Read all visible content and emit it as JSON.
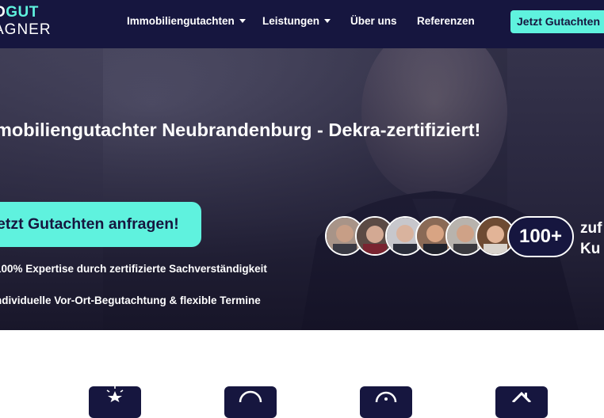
{
  "logo": {
    "line1_prefix": "O",
    "line1_highlight": "GUT",
    "line2": "AGNER"
  },
  "nav": {
    "items": [
      {
        "label": "Immobiliengutachten",
        "has_dropdown": true
      },
      {
        "label": "Leistungen",
        "has_dropdown": true
      },
      {
        "label": "Über uns",
        "has_dropdown": false
      },
      {
        "label": "Referenzen",
        "has_dropdown": false
      }
    ],
    "cta_label": "Jetzt Gutachten"
  },
  "hero": {
    "title": "mobiliengutachter Neubrandenburg - Dekra-zertifiziert!",
    "cta_label": "etzt Gutachten anfragen!",
    "features": [
      "100% Expertise durch zertifizierte Sachverständigkeit",
      "ndividuelle Vor-Ort-Begutachtung & flexible Termine"
    ],
    "customers": {
      "count": "100+",
      "label_line1": "zuf",
      "label_line2": "Ku"
    }
  },
  "colors": {
    "navy": "#16163f",
    "accent": "#5ff2de",
    "white": "#ffffff"
  },
  "service_icons": [
    "star-icon",
    "circle-icon",
    "badge-icon",
    "house-icon"
  ]
}
